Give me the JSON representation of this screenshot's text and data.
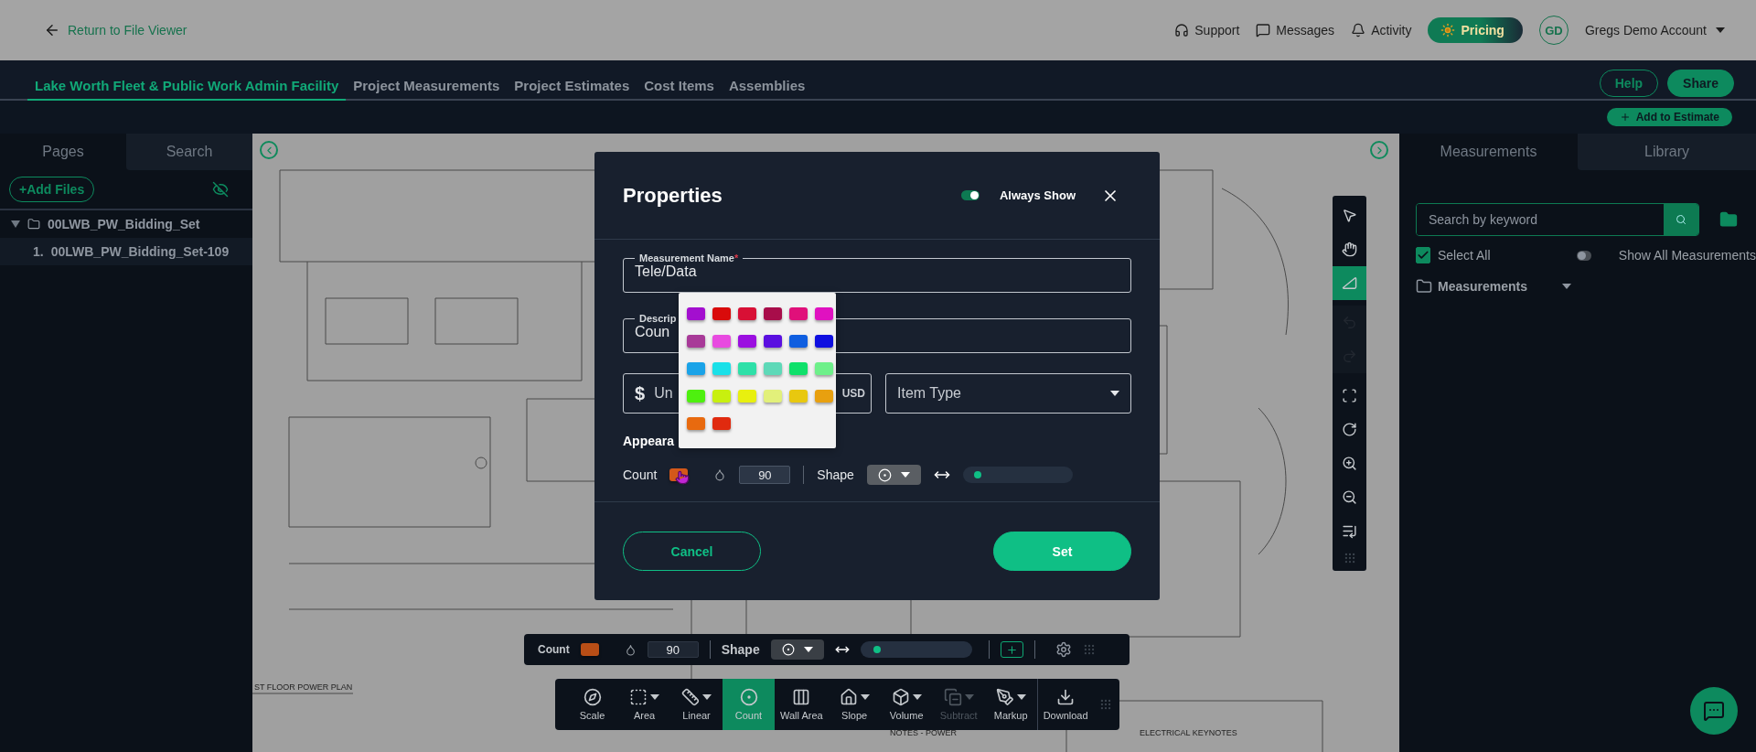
{
  "header": {
    "back_link": "Return to File Viewer",
    "links": [
      "Support",
      "Messages",
      "Activity"
    ],
    "pricing": "Pricing",
    "avatar": "GD",
    "account": "Gregs Demo Account"
  },
  "nav": {
    "tabs": [
      {
        "label": "Lake Worth Fleet & Public Work Admin Facility",
        "selected": true
      },
      {
        "label": "Project Measurements",
        "selected": false
      },
      {
        "label": "Project Estimates",
        "selected": false
      },
      {
        "label": "Cost Items",
        "selected": false
      },
      {
        "label": "Assemblies",
        "selected": false
      }
    ],
    "help": "Help",
    "share": "Share",
    "add_to_estimate": "Add to Estimate"
  },
  "left_panel": {
    "tabs": [
      {
        "label": "Pages",
        "selected": true
      },
      {
        "label": "Search",
        "selected": false
      }
    ],
    "add_files": "+Add Files",
    "tree": [
      {
        "label": "00LWB_PW_Bidding_Set",
        "expanded": true,
        "children": [
          {
            "number": "1.",
            "label": "00LWB_PW_Bidding_Set-109"
          }
        ]
      }
    ]
  },
  "canvas": {
    "labels": [
      "ST FLOOR POWER PLAN",
      "NOTES - POWER",
      "ELECTRICAL KEYNOTES"
    ]
  },
  "vertical_tools": [
    {
      "selected": false,
      "disabled": false
    },
    {
      "selected": false,
      "disabled": false
    },
    {
      "selected": true,
      "disabled": false
    },
    {
      "selected": false,
      "disabled": true
    },
    {
      "selected": false,
      "disabled": true
    },
    {
      "selected": false,
      "disabled": false
    },
    {
      "selected": false,
      "disabled": false
    },
    {
      "selected": false,
      "disabled": false
    },
    {
      "selected": false,
      "disabled": false
    },
    {
      "selected": false,
      "disabled": false
    }
  ],
  "right_panel": {
    "tabs": [
      {
        "label": "Measurements",
        "selected": true
      },
      {
        "label": "Library",
        "selected": false
      }
    ],
    "search": {
      "placeholder": "Search by keyword"
    },
    "select_all": {
      "label": "Select All",
      "checked": true
    },
    "show_all": {
      "label": "Show All Measurements",
      "on": false
    },
    "folder": {
      "label": "Measurements"
    }
  },
  "modal": {
    "title": "Properties",
    "always_show": {
      "label": "Always Show",
      "on": true
    },
    "name_field": {
      "label": "Measurement Name",
      "required_mark": "*",
      "value": "Tele/Data"
    },
    "description_field": {
      "label": "Descrip",
      "value": "Coun"
    },
    "cost_field": {
      "prefix": "$",
      "placeholder": "Un",
      "suffix": "USD"
    },
    "item_type": {
      "placeholder": "Item Type"
    },
    "section": "Appeara",
    "appearance": {
      "label": "Count",
      "color": "#d4581a",
      "opacity": "90",
      "shape_label": "Shape",
      "level": 0.1
    },
    "cancel": "Cancel",
    "set": "Set"
  },
  "color_picker": {
    "swatches": [
      {
        "color": "#a30fcf"
      },
      {
        "color": "#d90b0b"
      },
      {
        "color": "#d81035"
      },
      {
        "color": "#a80d4a"
      },
      {
        "color": "#e0107a"
      },
      {
        "color": "#e011c0"
      },
      {
        "color": "#a83a98"
      },
      {
        "color": "#e84ae0"
      },
      {
        "color": "#9b0fe0"
      },
      {
        "color": "#5a0fe0"
      },
      {
        "color": "#0f5ee0"
      },
      {
        "color": "#0f0fe0"
      },
      {
        "color": "#1aa3e8"
      },
      {
        "color": "#1ae0e8"
      },
      {
        "color": "#2ee0a8"
      },
      {
        "color": "#5ed9b8"
      },
      {
        "color": "#0fe06a"
      },
      {
        "color": "#6ef08a"
      },
      {
        "color": "#4ef00f"
      },
      {
        "color": "#c8f00f"
      },
      {
        "color": "#e8f00f"
      },
      {
        "color": "#e2f07a"
      },
      {
        "color": "#e8c80f"
      },
      {
        "color": "#e8a00f"
      },
      {
        "color": "#e86a0f"
      },
      {
        "color": "#e02a0f"
      }
    ]
  },
  "floating_bar": {
    "label": "Count",
    "color": "#b84e16",
    "opacity": "90",
    "shape_label": "Shape",
    "level": 0.12
  },
  "toolbar": [
    {
      "label": "Scale",
      "selected": false,
      "disabled": false,
      "dropdown": false
    },
    {
      "label": "Area",
      "selected": false,
      "disabled": false,
      "dropdown": true
    },
    {
      "label": "Linear",
      "selected": false,
      "disabled": false,
      "dropdown": true
    },
    {
      "label": "Count",
      "selected": true,
      "disabled": false,
      "dropdown": false
    },
    {
      "label": "Wall Area",
      "selected": false,
      "disabled": false,
      "dropdown": false
    },
    {
      "label": "Slope",
      "selected": false,
      "disabled": false,
      "dropdown": true
    },
    {
      "label": "Volume",
      "selected": false,
      "disabled": false,
      "dropdown": true
    },
    {
      "label": "Subtract",
      "selected": false,
      "disabled": true,
      "dropdown": true
    },
    {
      "label": "Markup",
      "selected": false,
      "disabled": false,
      "dropdown": true
    },
    {
      "label": "Download",
      "selected": false,
      "disabled": false,
      "dropdown": false
    }
  ]
}
